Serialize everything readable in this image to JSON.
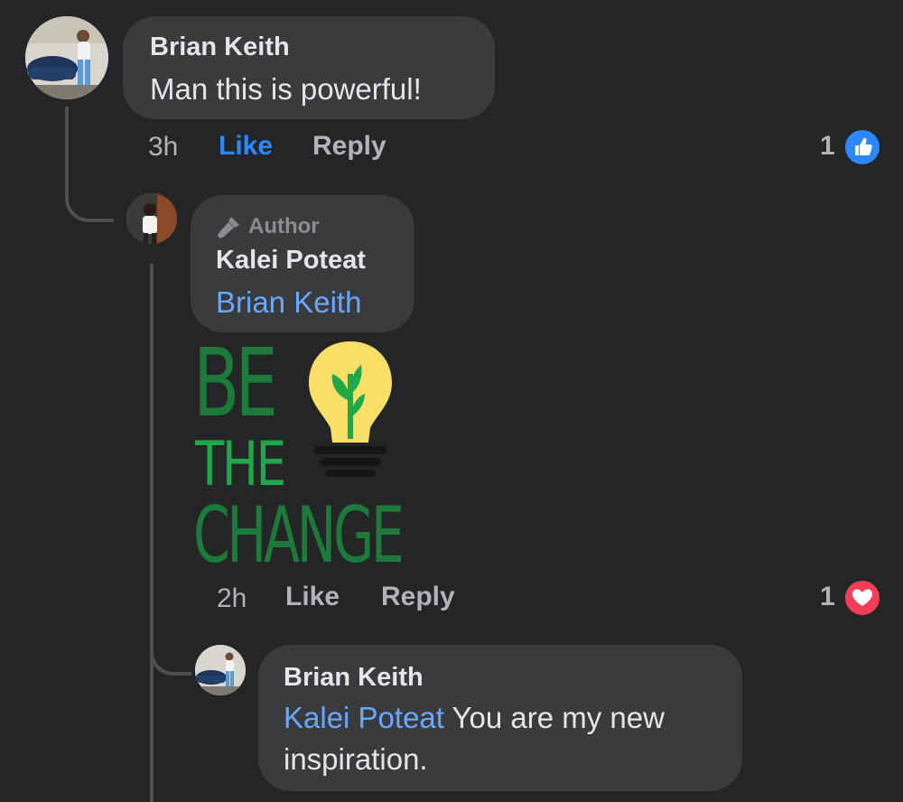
{
  "comments": [
    {
      "author": "Brian Keith",
      "text": "Man this is powerful!",
      "time": "3h",
      "like_label": "Like",
      "reply_label": "Reply",
      "reaction_count": "1",
      "reaction_icon": "like-thumb-icon"
    },
    {
      "badge": "Author",
      "author": "Kalei Poteat",
      "mention": "Brian Keith",
      "sticker": {
        "line1": "BE",
        "line2": "THE",
        "line3": "CHANGE"
      },
      "time": "2h",
      "like_label": "Like",
      "reply_label": "Reply",
      "reaction_count": "1",
      "reaction_icon": "love-heart-icon"
    },
    {
      "author": "Brian Keith",
      "mention": "Kalei Poteat",
      "text_line1": " You are my new",
      "text_line2": "inspiration."
    }
  ],
  "colors": {
    "background": "#242526",
    "bubble": "#3a3b3c",
    "mention": "#6aa8ff",
    "like_active": "#2d88ff",
    "love": "#f33e58",
    "sticker_green": "#1e7a3a",
    "bulb_yellow": "#f7df68"
  }
}
